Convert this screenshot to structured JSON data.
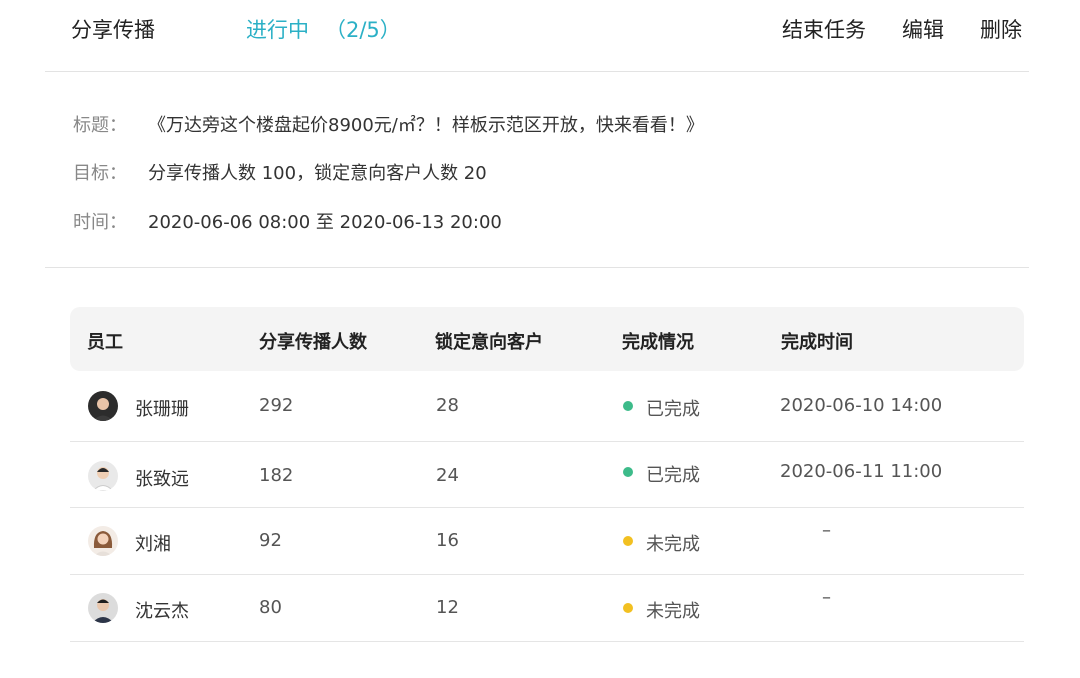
{
  "header": {
    "title": "分享传播",
    "status": "进行中",
    "progress": "（2/5）",
    "actions": {
      "end": "结束任务",
      "edit": "编辑",
      "delete": "删除"
    }
  },
  "info": {
    "title_label": "标题：",
    "title_value": "《万达旁这个楼盘起价8900元/㎡？！样板示范区开放，快来看看！》",
    "goal_label": "目标：",
    "goal_value": "分享传播人数 100，锁定意向客户人数 20",
    "time_label": "时间：",
    "time_value": "2020-06-06 08:00 至 2020-06-13 20:00"
  },
  "table": {
    "columns": [
      "员工",
      "分享传播人数",
      "锁定意向客户",
      "完成情况",
      "完成时间"
    ],
    "rows": [
      {
        "name": "张珊珊",
        "shares": "292",
        "leads": "28",
        "status": "已完成",
        "time": "2020-06-10  14:00"
      },
      {
        "name": "张致远",
        "shares": "182",
        "leads": "24",
        "status": "已完成",
        "time": "2020-06-11  11:00"
      },
      {
        "name": "刘湘",
        "shares": "92",
        "leads": "16",
        "status": "未完成",
        "time": "–"
      },
      {
        "name": "沈云杰",
        "shares": "80",
        "leads": "12",
        "status": "未完成",
        "time": "–"
      }
    ]
  },
  "colors": {
    "accent": "#2bb0c6",
    "done": "#3dbb8a",
    "pending": "#f2c021"
  }
}
